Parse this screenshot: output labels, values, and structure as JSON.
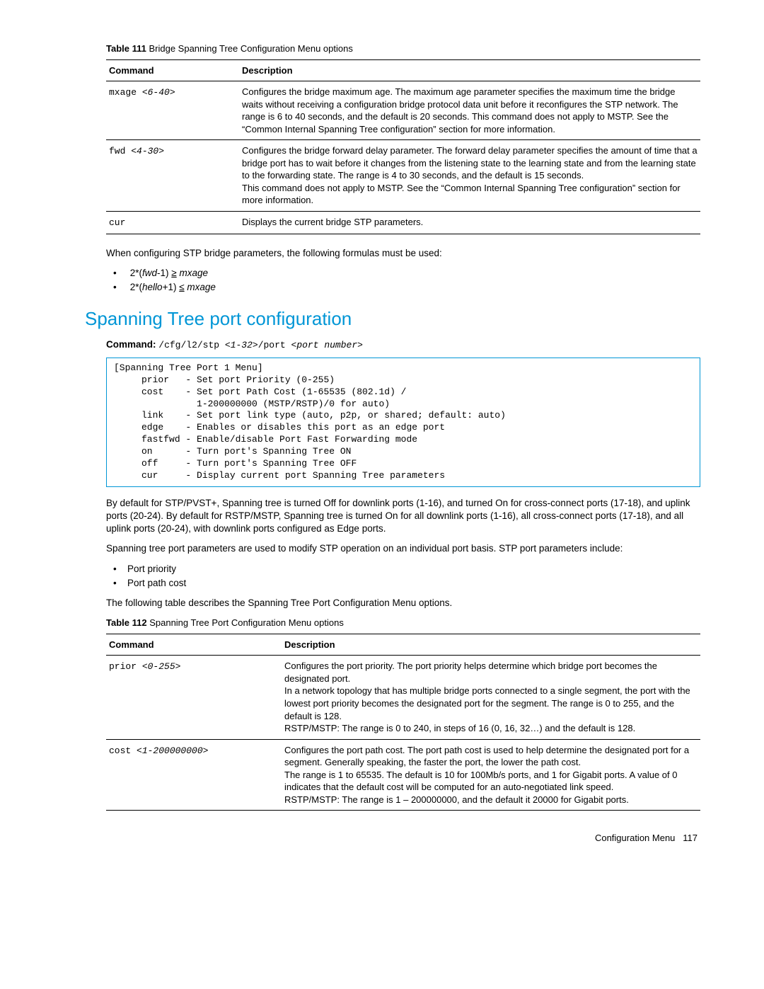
{
  "table111": {
    "caption_label": "Table 111",
    "caption_text": "Bridge Spanning Tree Configuration Menu options",
    "headers": {
      "c1": "Command",
      "c2": "Description"
    },
    "rows": [
      {
        "cmd_base": "mxage ",
        "cmd_arg": "<6-40>",
        "desc": "Configures the bridge maximum age. The maximum age parameter specifies the maximum time the bridge waits without receiving a configuration bridge protocol data unit before it reconfigures the STP network. The range is 6 to 40 seconds, and the default is 20 seconds. This command does not apply to MSTP. See the “Common Internal Spanning Tree configuration” section for more information."
      },
      {
        "cmd_base": "fwd ",
        "cmd_arg": "<4-30>",
        "desc": "Configures the bridge forward delay parameter. The forward delay parameter specifies the amount of time that a bridge port has to wait before it changes from the listening state to the learning state and from the learning state to the forwarding state. The range is 4 to 30 seconds, and the default is 15 seconds.\nThis command does not apply to MSTP. See the “Common Internal Spanning Tree configuration” section for more information."
      },
      {
        "cmd_base": "cur",
        "cmd_arg": "",
        "desc": "Displays the current bridge STP parameters."
      }
    ]
  },
  "para1": "When configuring STP bridge parameters, the following formulas must be used:",
  "formulas": {
    "f1_a": "2*(",
    "f1_b": "fwd",
    "f1_c": "-1) ",
    "f1_d": "≥",
    "f1_e": " mxage",
    "f2_a": "2*(",
    "f2_b": "hello",
    "f2_c": "+1) ",
    "f2_d": "≤",
    "f2_e": " mxage"
  },
  "section_heading": "Spanning Tree port configuration",
  "command_label": "Command:",
  "command_text_a": "/cfg/l2/stp ",
  "command_text_b": "<1-32>",
  "command_text_c": "/port ",
  "command_text_d": "<port number>",
  "menu_box": "[Spanning Tree Port 1 Menu]\n     prior   - Set port Priority (0-255)\n     cost    - Set port Path Cost (1-65535 (802.1d) /\n               1-200000000 (MSTP/RSTP)/0 for auto)\n     link    - Set port link type (auto, p2p, or shared; default: auto)\n     edge    - Enables or disables this port as an edge port\n     fastfwd - Enable/disable Port Fast Forwarding mode\n     on      - Turn port's Spanning Tree ON\n     off     - Turn port's Spanning Tree OFF\n     cur     - Display current port Spanning Tree parameters",
  "para2": "By default for STP/PVST+, Spanning tree is turned Off for downlink ports (1-16), and turned On for cross-connect ports (17-18), and uplink ports (20-24). By default for RSTP/MSTP, Spanning tree is turned On for all downlink ports (1-16), all cross-connect ports (17-18), and all uplink ports (20-24), with downlink ports configured as Edge ports.",
  "para3": "Spanning tree port parameters are used to modify STP operation on an individual port basis. STP port parameters include:",
  "bullets2": {
    "b1": "Port priority",
    "b2": "Port path cost"
  },
  "para4": "The following table describes the Spanning Tree Port Configuration Menu options.",
  "table112": {
    "caption_label": "Table 112",
    "caption_text": "Spanning Tree Port Configuration Menu options",
    "headers": {
      "c1": "Command",
      "c2": "Description"
    },
    "rows": [
      {
        "cmd_base": "prior ",
        "cmd_arg": "<0-255>",
        "desc": "Configures the port priority. The port priority helps determine which bridge port becomes the designated port.\nIn a network topology that has multiple bridge ports connected to a single segment, the port with the lowest port priority becomes the designated port for the segment. The range is 0 to 255, and the default is 128.\nRSTP/MSTP: The range is 0 to 240, in steps of 16 (0, 16, 32…) and the default is 128."
      },
      {
        "cmd_base": "cost ",
        "cmd_arg": "<1-200000000>",
        "desc": "Configures the port path cost. The port path cost is used to help determine the designated port for a segment. Generally speaking, the faster the port, the lower the path cost.\nThe range is 1 to 65535. The default is 10 for 100Mb/s ports, and 1 for Gigabit ports. A value of 0 indicates that the default cost will be computed for an auto-negotiated link speed.\nRSTP/MSTP: The range is 1 – 200000000, and the default it 20000 for Gigabit ports."
      }
    ]
  },
  "footer": {
    "section": "Configuration Menu",
    "page": "117"
  }
}
